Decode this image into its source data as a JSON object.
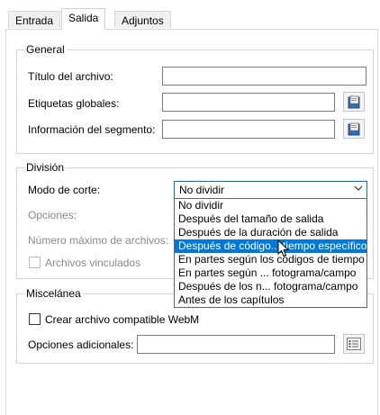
{
  "tabs": [
    {
      "label": "Entrada"
    },
    {
      "label": "Salida"
    },
    {
      "label": "Adjuntos"
    }
  ],
  "active_tab": "Salida",
  "general": {
    "title": "General",
    "file_title_label": "Título del archivo:",
    "file_title_value": "",
    "global_tags_label": "Etiquetas globales:",
    "global_tags_value": "",
    "segment_info_label": "Información del segmento:",
    "segment_info_value": ""
  },
  "split": {
    "title": "División",
    "mode_label": "Modo de corte:",
    "mode_value": "No dividir",
    "options_label": "Opciones:",
    "max_files_label": "Número máximo de archivos:",
    "linked_files_label": "Archivos vinculados",
    "linked_files_checked": false,
    "dropdown_options": [
      "No dividir",
      "Después del tamaño de salida",
      "Después de la duración de salida",
      "Después de código... tiempo específicos",
      "En partes según los códigos de tiempo",
      "En partes según ... fotograma/campo",
      "Después de los n... fotograma/campo",
      "Antes de los capítulos"
    ],
    "highlighted_option_index": 3
  },
  "misc": {
    "title": "Miscelánea",
    "webm_label": "Crear archivo compatible WebM",
    "webm_checked": false,
    "additional_options_label": "Opciones adicionales:",
    "additional_options_value": ""
  },
  "icons": {
    "browse": "document-edit-icon",
    "options": "options-list-icon",
    "dropdown": "chevron-down-icon",
    "cursor": "mouse-pointer-icon"
  },
  "colors": {
    "accent": "#0078d7",
    "group_border": "#d5d5d5",
    "disabled_text": "#8a8a8a"
  }
}
